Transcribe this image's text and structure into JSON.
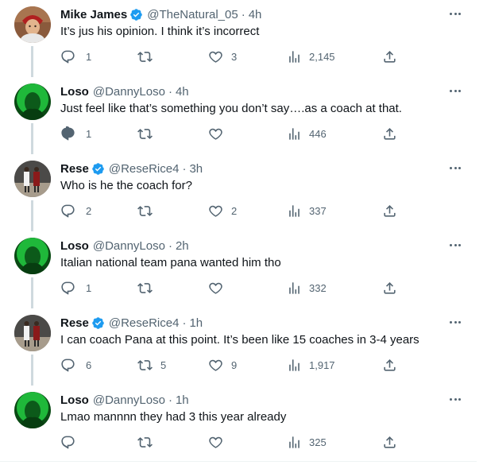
{
  "tweets": [
    {
      "name": "Mike James",
      "verified": true,
      "handle": "@TheNatural_05",
      "time": "4h",
      "text": "It’s jus his opinion. I think it’s incorrect",
      "replies": "1",
      "retweets": "",
      "likes": "3",
      "views": "2,145",
      "avatar": "child-avatar"
    },
    {
      "name": "Loso",
      "verified": false,
      "handle": "@DannyLoso",
      "time": "4h",
      "text": "Just feel like that’s something you don’t say….as a coach at that.",
      "replies": "1",
      "retweets": "",
      "likes": "",
      "views": "446",
      "avatar": "green-avatar"
    },
    {
      "name": "Rese",
      "verified": true,
      "handle": "@ReseRice4",
      "time": "3h",
      "text": "Who is he the coach for?",
      "replies": "2",
      "retweets": "",
      "likes": "2",
      "views": "337",
      "avatar": "court-avatar"
    },
    {
      "name": "Loso",
      "verified": false,
      "handle": "@DannyLoso",
      "time": "2h",
      "text": "Italian national team pana wanted him tho",
      "replies": "1",
      "retweets": "",
      "likes": "",
      "views": "332",
      "avatar": "green-avatar"
    },
    {
      "name": "Rese",
      "verified": true,
      "handle": "@ReseRice4",
      "time": "1h",
      "text": "I can coach Pana at this point. It’s been like 15 coaches in 3-4 years",
      "replies": "6",
      "retweets": "5",
      "likes": "9",
      "views": "1,917",
      "avatar": "court-avatar"
    },
    {
      "name": "Loso",
      "verified": false,
      "handle": "@DannyLoso",
      "time": "1h",
      "text": "Lmao mannnn they had 3 this year already",
      "replies": "",
      "retweets": "",
      "likes": "",
      "views": "325",
      "avatar": "green-avatar"
    }
  ],
  "separator": "·",
  "colors": {
    "verified": "#1d9bf0",
    "secondary": "#536471",
    "connector": "#cfd9de"
  }
}
